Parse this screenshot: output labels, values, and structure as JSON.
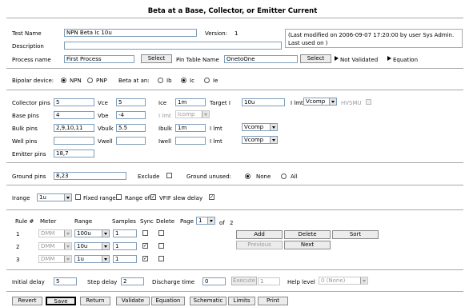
{
  "header": {
    "title": "Beta at a Base, Collector, or Emitter Current"
  },
  "test": {
    "name_label": "Test Name",
    "name_value": "NPN Beta Ic 10u",
    "version_label": "Version:",
    "version_value": "1",
    "description_label": "Description",
    "description_value": "",
    "process_label": "Process name",
    "process_value": "First Process",
    "select_label": "Select",
    "pin_table_label": "Pin Table Name",
    "pin_table_value": "OnetoOne",
    "not_validated": "Not Validated",
    "equation": "Equation",
    "modified_line1": "(Last modified on 2006-09-07 17:20:00 by user Sys Admin.",
    "modified_line2": "Last used on )"
  },
  "bipolar": {
    "label": "Bipolar device:",
    "npn": "NPN",
    "pnp": "PNP",
    "beta_label": "Beta at an:",
    "ib": "Ib",
    "ic": "Ic",
    "ie": "Ie"
  },
  "pins": {
    "collector_label": "Collector pins",
    "collector_value": "5",
    "vce_label": "Vce",
    "vce_value": "5",
    "ice_label": "Ice",
    "ice_value": "1m",
    "target_label": "Target I",
    "target_value": "10u",
    "ilmt_label": "I lmt",
    "vcomp": "Vcomp",
    "hvsmu": "HVSMU",
    "base_label": "Base pins",
    "base_value": "4",
    "vbe_label": "Vbe",
    "vbe_value": "-4",
    "icomp": "Icomp",
    "bulk_label": "Bulk pins",
    "bulk_value": "2,9,10,11",
    "vbulk_label": "Vbulk",
    "vbulk_value": "5.5",
    "ibulk_label": "Ibulk",
    "ibulk_value": "1m",
    "well_label": "Well pins",
    "well_value": "",
    "vwell_label": "Vwell",
    "vwell_value": "",
    "iwell_label": "Iwell",
    "iwell_value": "",
    "emitter_label": "Emitter pins",
    "emitter_value": "18,7"
  },
  "ground": {
    "label": "Ground pins",
    "value": "8,23",
    "exclude": "Exclude",
    "unused": "Ground unused:",
    "none": "None",
    "all": "All"
  },
  "range": {
    "label": "Irange",
    "value": "1u",
    "fixed": "Fixed range",
    "off": "Range off",
    "vfif": "VFIF slew delay"
  },
  "rules": {
    "headers": {
      "rule": "Rule #",
      "meter": "Meter",
      "range": "Range",
      "samples": "Samples",
      "sync": "Sync",
      "delete": "Delete",
      "page": "Page",
      "page_value": "1",
      "of": "of",
      "pages": "2"
    },
    "rows": [
      {
        "num": "1",
        "meter": "DMM",
        "range": "100u",
        "samples": "1",
        "sync": false,
        "del": false
      },
      {
        "num": "2",
        "meter": "DMM",
        "range": "10u",
        "samples": "1",
        "sync": true,
        "del": false
      },
      {
        "num": "3",
        "meter": "DMM",
        "range": "1u",
        "samples": "1",
        "sync": true,
        "del": false
      }
    ],
    "add": "Add",
    "delete_btn": "Delete",
    "sort": "Sort",
    "previous": "Previous",
    "next": "Next"
  },
  "timing": {
    "initial_label": "Initial delay",
    "initial_value": "5",
    "step_label": "Step delay",
    "step_value": "2",
    "discharge_label": "Discharge time",
    "discharge_value": "0",
    "execute": "Execute",
    "execute_value": "1",
    "help_label": "Help level",
    "help_value": "0 (None)"
  },
  "footer": {
    "revert": "Revert",
    "save": "Save",
    "return": "Return",
    "validate": "Validate",
    "equation": "Equation",
    "schematic": "Schematic",
    "limits": "Limits",
    "print": "Print"
  }
}
